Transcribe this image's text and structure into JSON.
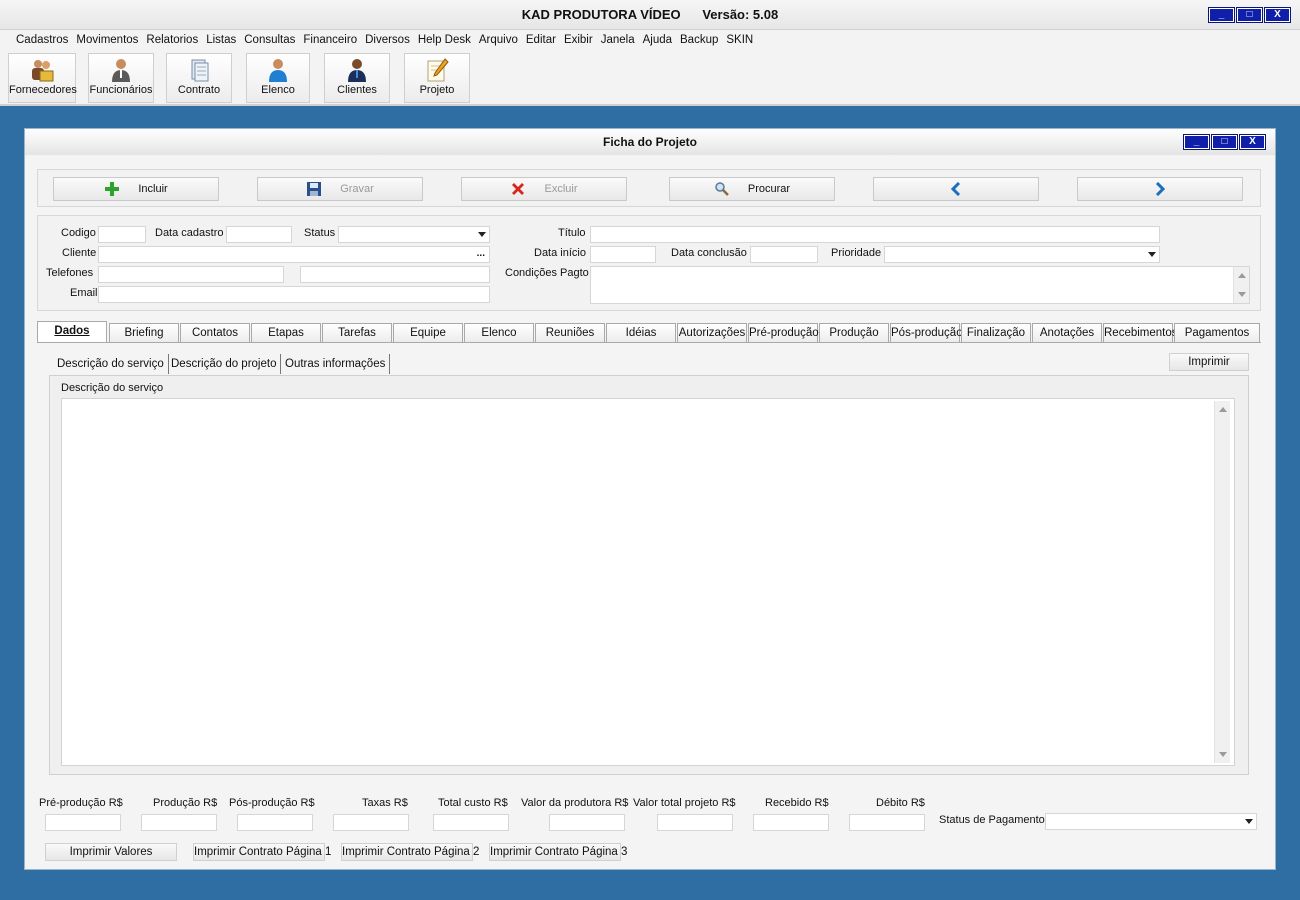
{
  "app": {
    "title": "KAD PRODUTORA VÍDEO",
    "version": "Versão: 5.08",
    "window_controls": {
      "minimize": "_",
      "maximize": "□",
      "close": "X"
    }
  },
  "menu": [
    "Cadastros",
    "Movimentos",
    "Relatorios",
    "Listas",
    "Consultas",
    "Financeiro",
    "Diversos",
    "Help Desk",
    "Arquivo",
    "Editar",
    "Exibir",
    "Janela",
    "Ajuda",
    "Backup",
    "SKIN"
  ],
  "toolbar": [
    {
      "label": "Fornecedores",
      "icon": "suppliers-icon"
    },
    {
      "label": "Funcionários",
      "icon": "employee-icon"
    },
    {
      "label": "Contrato",
      "icon": "contract-icon"
    },
    {
      "label": "Elenco",
      "icon": "cast-icon"
    },
    {
      "label": "Clientes",
      "icon": "clients-icon"
    },
    {
      "label": "Projeto",
      "icon": "project-icon"
    }
  ],
  "form": {
    "title": "Ficha do Projeto",
    "actions": {
      "incluir": "Incluir",
      "gravar": "Gravar",
      "excluir": "Excluir",
      "procurar": "Procurar"
    },
    "fields": {
      "codigo": "Codigo",
      "data_cadastro": "Data cadastro",
      "status": "Status",
      "cliente": "Cliente",
      "cliente_button": "...",
      "telefones": "Telefones",
      "email": "Email",
      "titulo": "Título",
      "data_inicio": "Data início",
      "data_conclusao": "Data conclusão",
      "prioridade": "Prioridade",
      "condicoes_pagto": "Condições Pagto"
    },
    "tabs": [
      "Dados",
      "Briefing",
      "Contatos",
      "Etapas",
      "Tarefas",
      "Equipe",
      "Elenco",
      "Reuniões",
      "Idéias",
      "Autorizações",
      "Pré-produção",
      "Produção",
      "Pós-produção",
      "Finalização",
      "Anotações",
      "Recebimentos",
      "Pagamentos"
    ],
    "active_tab": "Dados",
    "subtabs": [
      "Descrição do serviço",
      "Descrição do projeto",
      "Outras informações"
    ],
    "print_button": "Imprimir",
    "description_label": "Descrição do serviço",
    "totals": {
      "pre_producao": "Pré-produção R$",
      "producao": "Produção R$",
      "pos_producao": "Pós-produção R$",
      "taxas": "Taxas R$",
      "total_custo": "Total custo R$",
      "valor_produtora": "Valor da produtora R$",
      "valor_total": "Valor total projeto R$",
      "recebido": "Recebido R$",
      "debito": "Débito R$",
      "status_pagamento": "Status de Pagamento"
    },
    "print_buttons": [
      "Imprimir Valores",
      "Imprimir Contrato Página 1",
      "Imprimir Contrato Página 2",
      "Imprimir Contrato Página 3"
    ]
  },
  "colors": {
    "desktop": "#2f6ea3",
    "window_button": "#0f1faa",
    "green_plus": "#2fa12f",
    "red_x": "#d9261c",
    "blue_arrow": "#1a6fc1"
  }
}
